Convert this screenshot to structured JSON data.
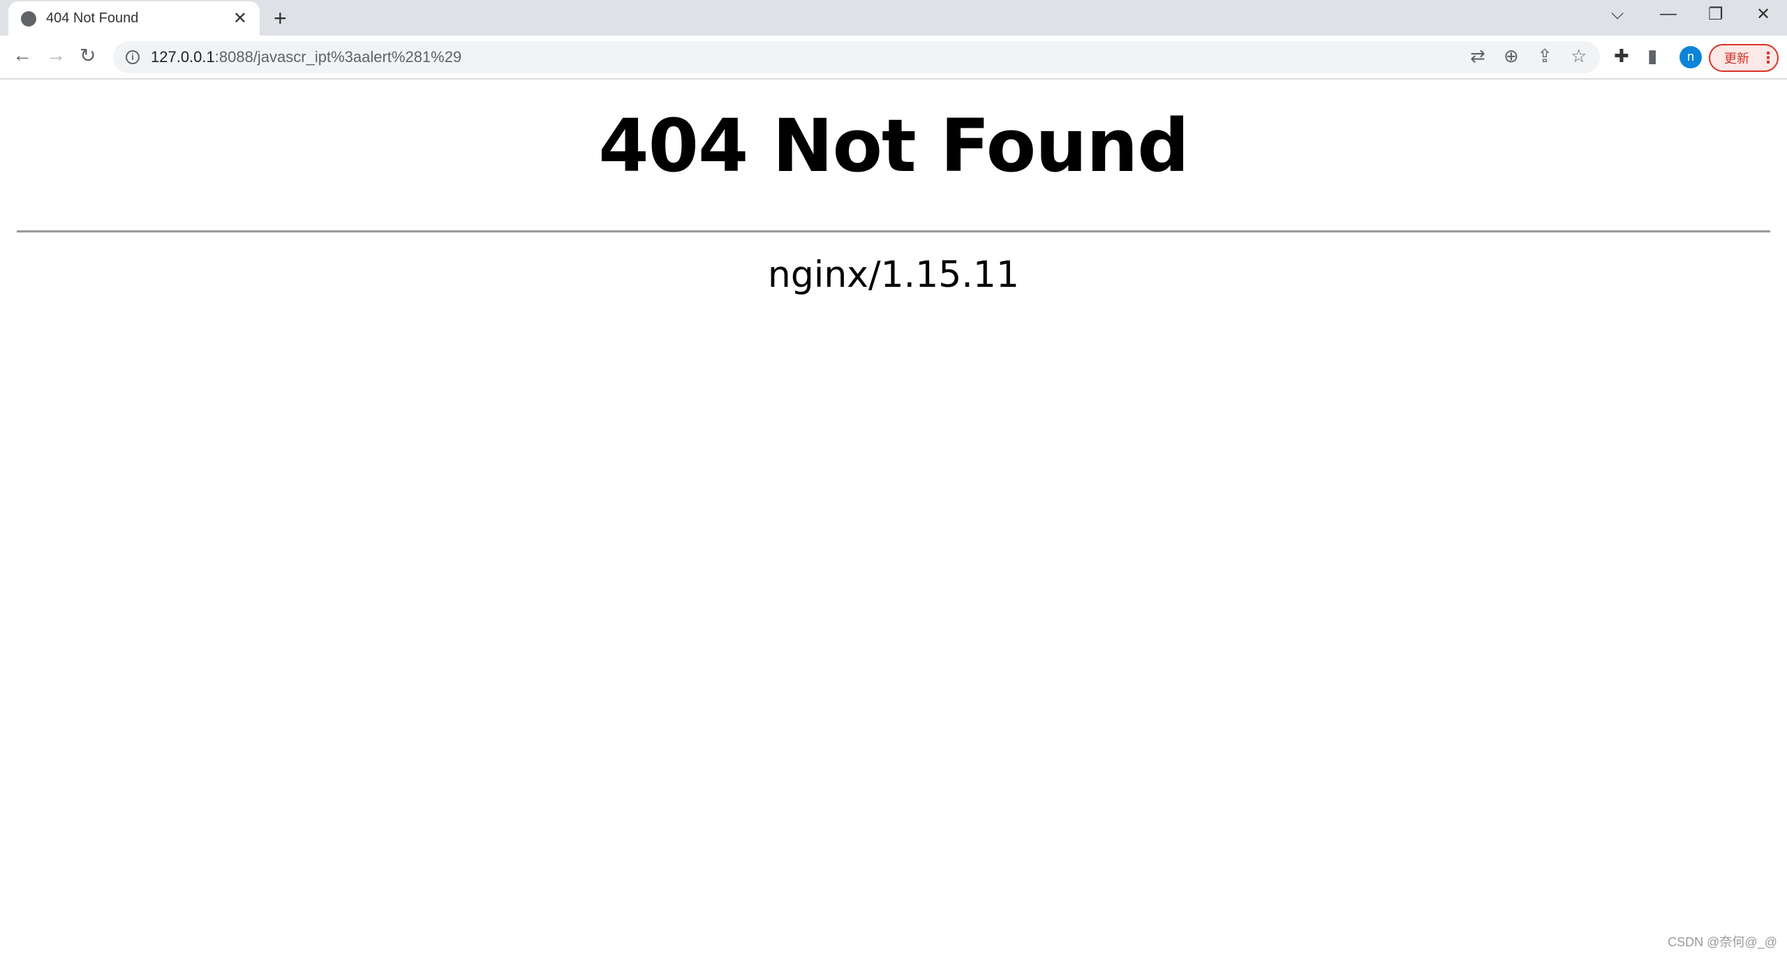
{
  "browser": {
    "tab": {
      "title": "404 Not Found",
      "favicon": "globe-icon"
    },
    "url": {
      "host": "127.0.0.1",
      "path": ":8088/javascr_ipt%3aalert%281%29"
    },
    "profile_initial": "n",
    "update_label": "更新",
    "colors": {
      "update": "#d93025",
      "avatar": "#0b84d9"
    }
  },
  "page": {
    "heading": "404 Not Found",
    "server": "nginx/1.15.11"
  },
  "watermark": "CSDN @奈何@_@"
}
